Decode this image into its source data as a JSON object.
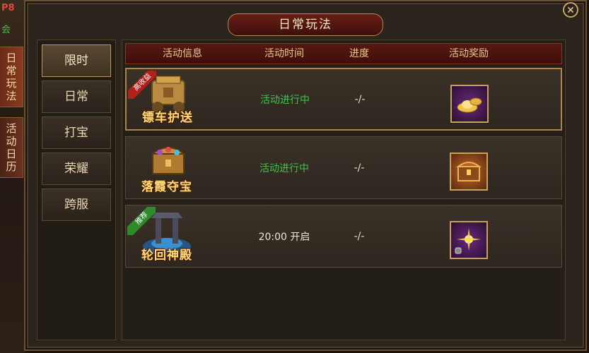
{
  "hud": {
    "level_tag": "P8",
    "guild_tag": "会"
  },
  "side_tabs": [
    {
      "label": "日常玩法",
      "active": true
    },
    {
      "label": "活动日历",
      "active": false
    }
  ],
  "window": {
    "title": "日常玩法",
    "close_label": "✕"
  },
  "nav": [
    {
      "label": "限时",
      "active": true
    },
    {
      "label": "日常",
      "active": false
    },
    {
      "label": "打宝",
      "active": false
    },
    {
      "label": "荣耀",
      "active": false
    },
    {
      "label": "跨服",
      "active": false
    }
  ],
  "table": {
    "headers": [
      "活动信息",
      "活动时间",
      "进度",
      "活动奖励"
    ],
    "rows": [
      {
        "name": "镖车护送",
        "ribbon": "高收益",
        "time": "活动进行中",
        "progress": "-/-",
        "reward": "gold-ingot-icon",
        "selected": true
      },
      {
        "name": "落霞夺宝",
        "ribbon": "",
        "time": "活动进行中",
        "progress": "-/-",
        "reward": "treasure-chest-icon",
        "selected": false
      },
      {
        "name": "轮回神殿",
        "ribbon": "推荐",
        "time": "20:00 开启",
        "progress": "-/-",
        "reward": "sparkle-orb-icon",
        "selected": false
      }
    ]
  },
  "colors": {
    "in_progress": "#3fc24c",
    "accent_gold": "#c8a060",
    "header_red": "#5a1812"
  }
}
